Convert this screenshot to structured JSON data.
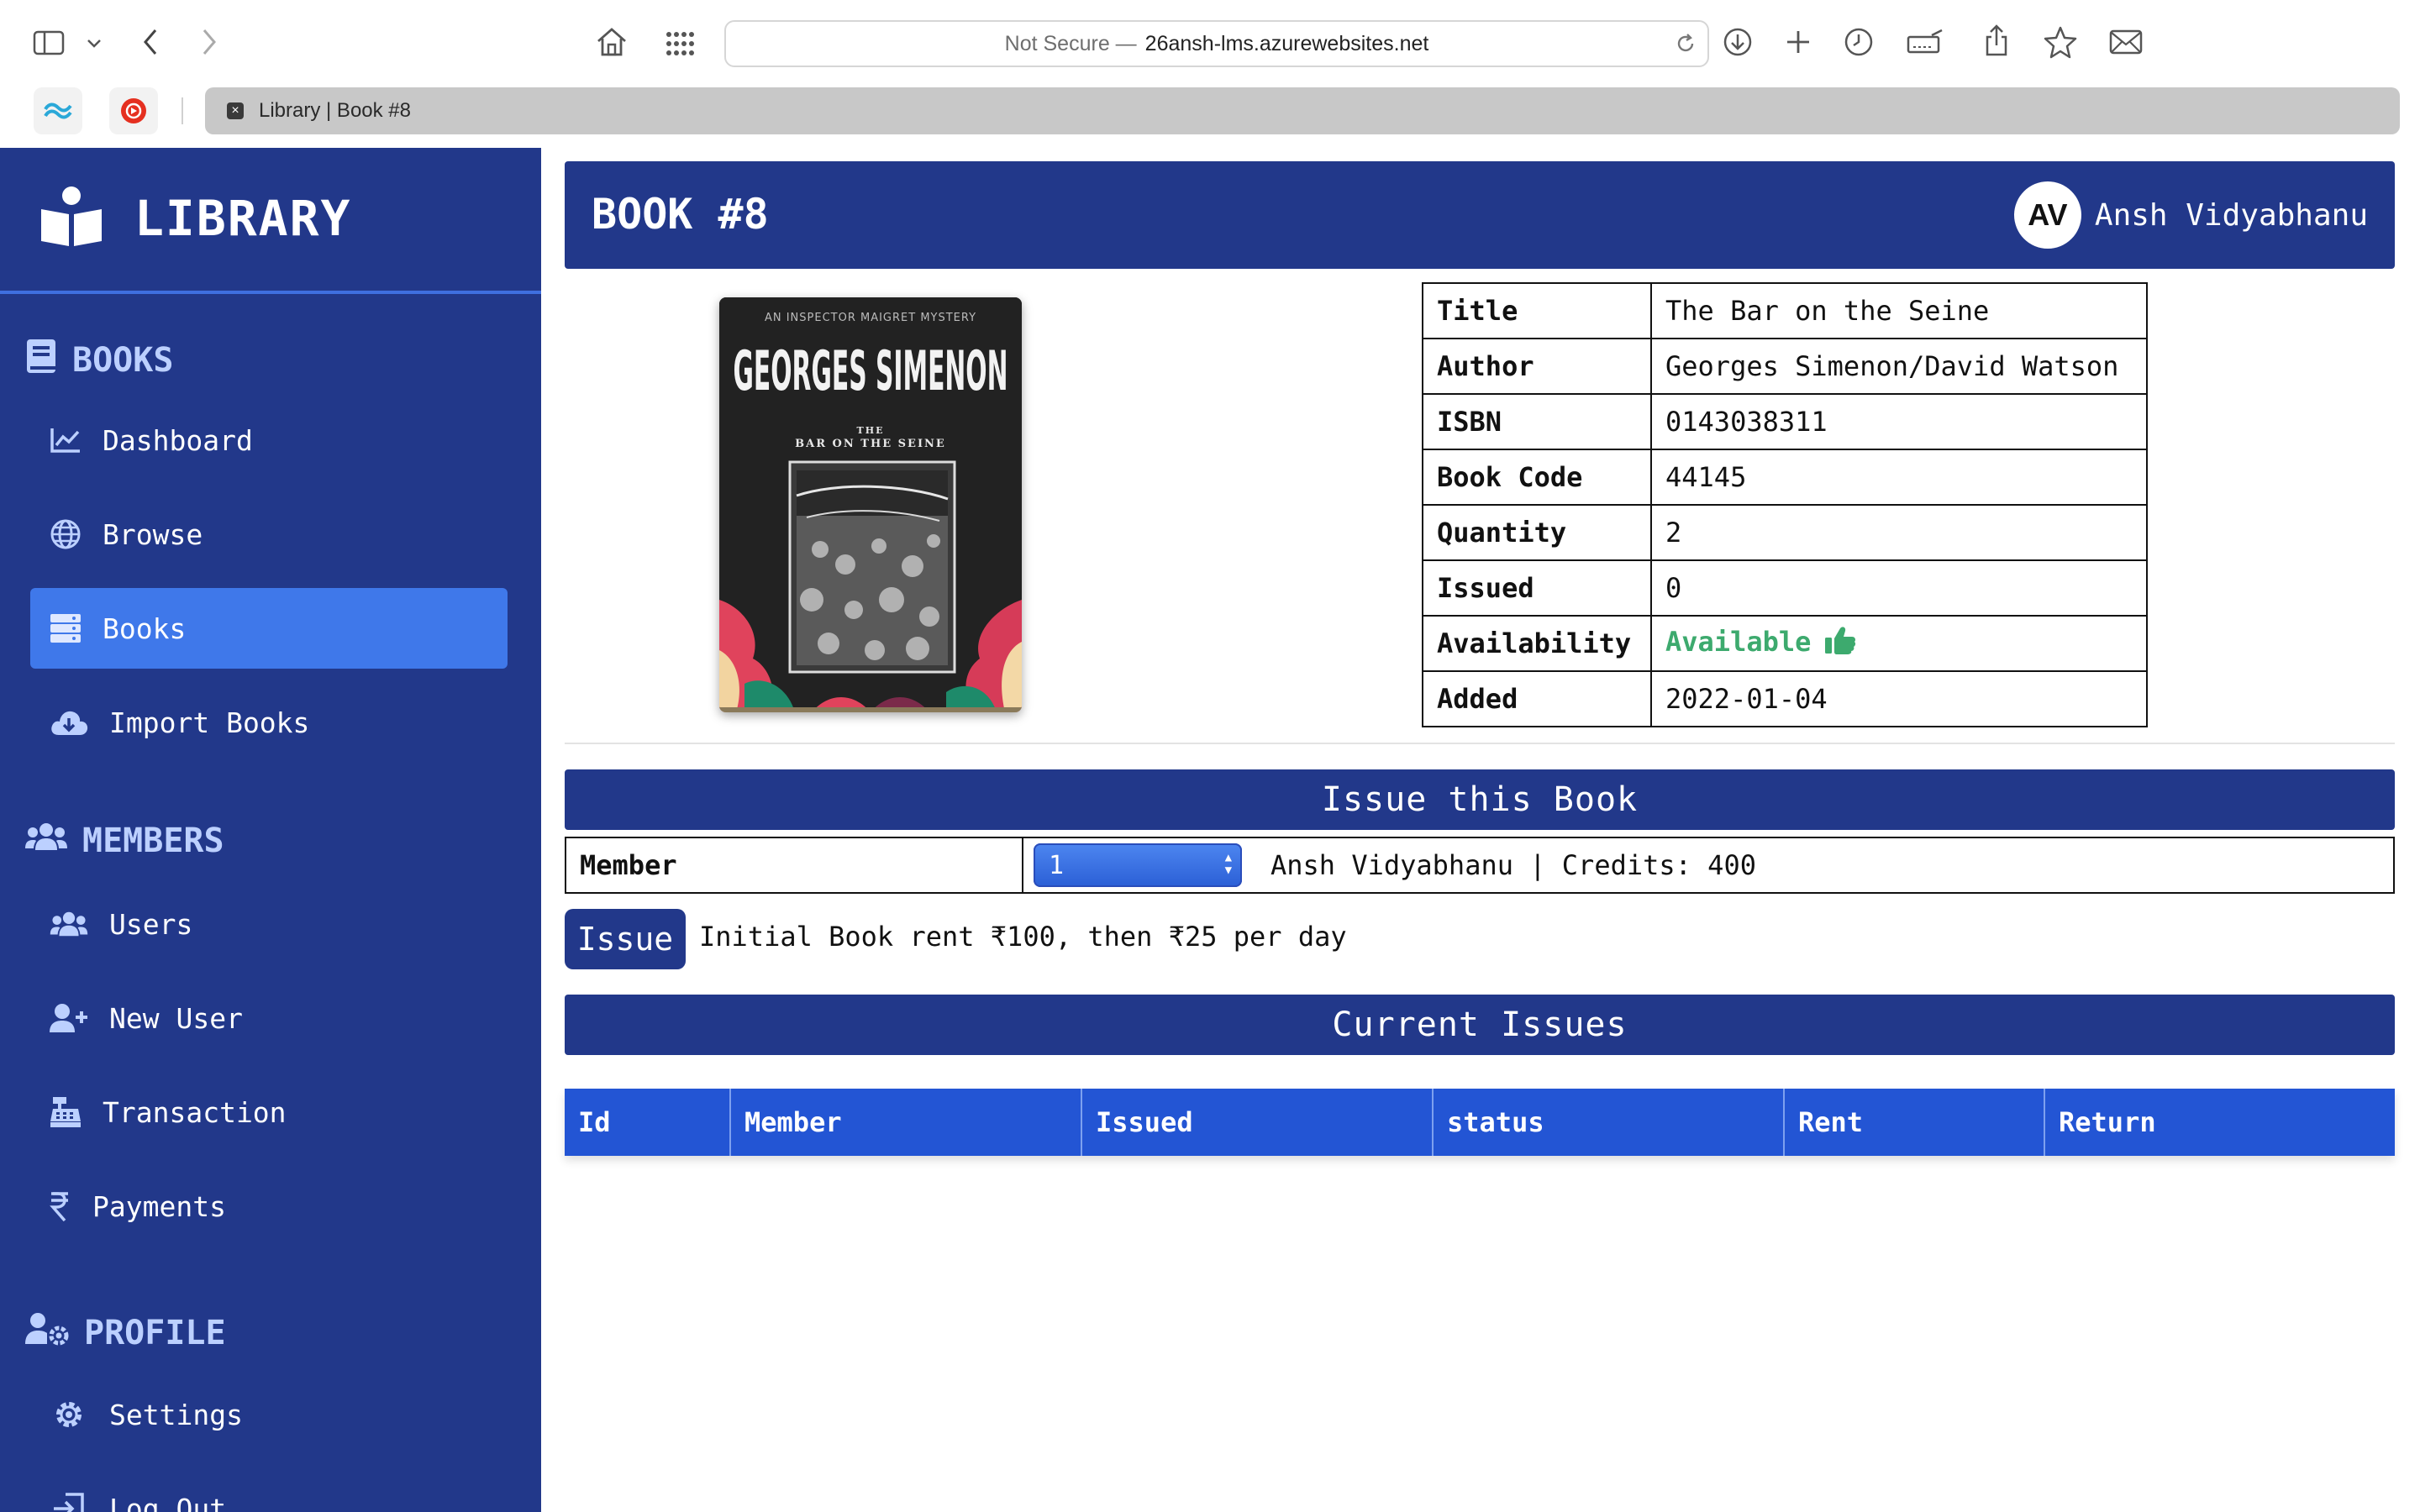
{
  "browser": {
    "address_prefix": "Not Secure —",
    "address_host": "26ansh-lms.azurewebsites.net",
    "tab_title": "Library | Book #8"
  },
  "sidebar": {
    "brand": "LIBRARY",
    "sections": {
      "books": "BOOKS",
      "members": "MEMBERS",
      "profile": "PROFILE"
    },
    "items": {
      "dashboard": "Dashboard",
      "browse": "Browse",
      "books": "Books",
      "import_books": "Import Books",
      "users": "Users",
      "new_user": "New User",
      "transaction": "Transaction",
      "payments": "Payments",
      "settings": "Settings",
      "log_out": "Log Out"
    },
    "active_item": "Books"
  },
  "header": {
    "title": "BOOK #8",
    "avatar_initials": "AV",
    "user_name": "Ansh Vidyabhanu"
  },
  "book": {
    "cover": {
      "series": "AN INSPECTOR MAIGRET MYSTERY",
      "author": "GEORGES SIMENON",
      "title_small": "THE",
      "title_main": "BAR ON THE SEINE"
    },
    "details": [
      {
        "label": "Title",
        "value": "The Bar on the Seine"
      },
      {
        "label": "Author",
        "value": "Georges Simenon/David Watson"
      },
      {
        "label": "ISBN",
        "value": "0143038311"
      },
      {
        "label": "Book Code",
        "value": "44145"
      },
      {
        "label": "Quantity",
        "value": "2"
      },
      {
        "label": "Issued",
        "value": "0"
      },
      {
        "label": "Availability",
        "value": "Available"
      },
      {
        "label": "Added",
        "value": "2022-01-04"
      }
    ]
  },
  "issue": {
    "heading": "Issue this Book",
    "member_label": "Member",
    "selected_member": "1",
    "member_info": "Ansh Vidyabhanu | Credits: 400",
    "button": "Issue",
    "rent_note": "Initial Book rent ₹100, then ₹25 per day"
  },
  "current_issues": {
    "heading": "Current Issues",
    "columns": [
      "Id",
      "Member",
      "Issued",
      "status",
      "Rent",
      "Return"
    ]
  },
  "colors": {
    "primary": "#22388a",
    "accent": "#3f78ea",
    "table_header": "#2355d4",
    "available": "#3daa6e"
  }
}
